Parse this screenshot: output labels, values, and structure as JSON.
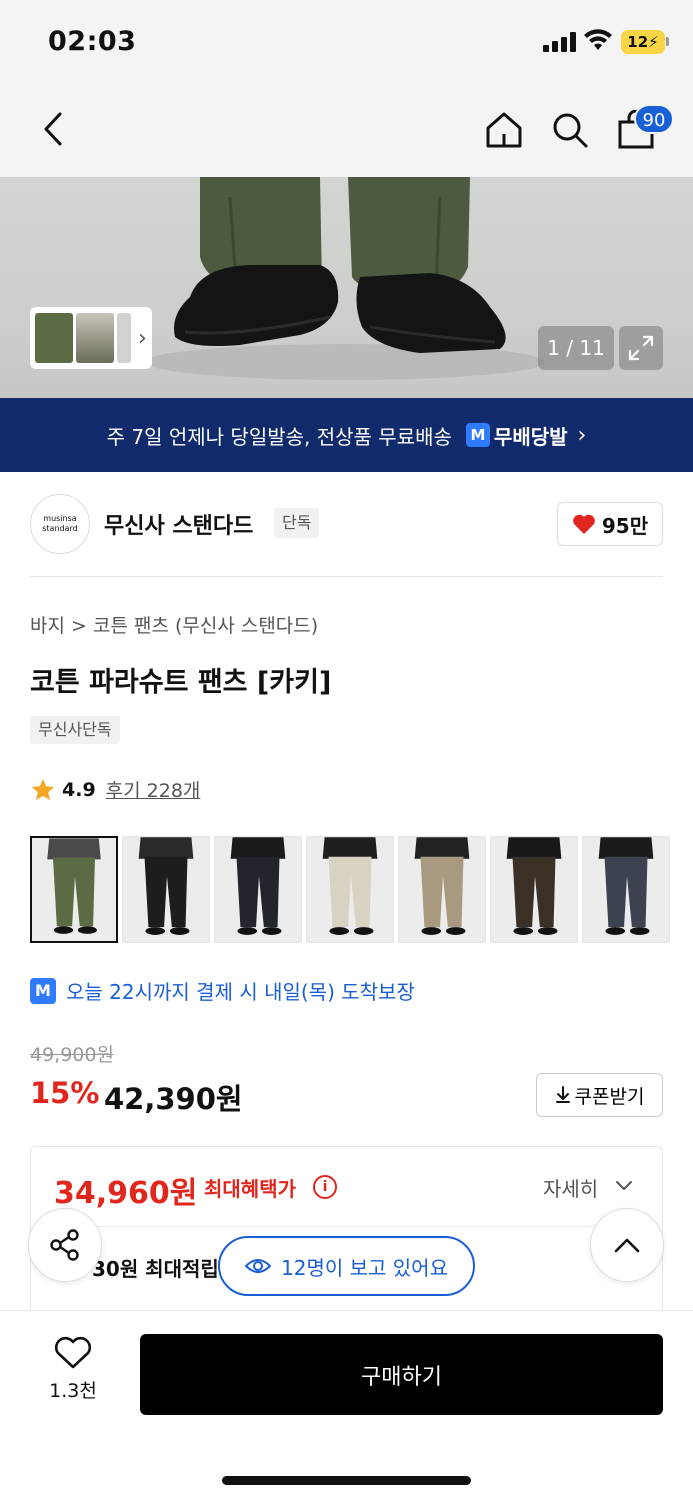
{
  "status_bar": {
    "time": "02:03",
    "battery": "12"
  },
  "nav": {
    "cart_count": "90"
  },
  "gallery": {
    "counter": "1 / 11"
  },
  "banner": {
    "text": "주 7일 언제나 당일발송, 전상품 무료배송",
    "badge_letter": "M",
    "brand": "무배당발",
    "chevron": "›"
  },
  "brand": {
    "logo_line1": "musinsa",
    "logo_line2": "standard",
    "name": "무신사 스탠다드",
    "tag": "단독",
    "likes": "95만"
  },
  "product": {
    "breadcrumb": "바지 > 코튼 팬츠 (무신사 스탠다드)",
    "title": "코튼 파라슈트 팬츠 [카키]",
    "tag": "무신사단독",
    "rating": "4.9",
    "reviews": "후기 228개",
    "colors": [
      {
        "pants": "#5b6b44",
        "top": "#4a4a4a",
        "selected": true
      },
      {
        "pants": "#1d1d1d",
        "top": "#2a2a2a"
      },
      {
        "pants": "#22262c",
        "top": "#1a1a1a"
      },
      {
        "pants": "#d8d2c2",
        "top": "#1f1f1f"
      },
      {
        "pants": "#a89a80",
        "top": "#222222"
      },
      {
        "pants": "#3a3026",
        "top": "#181818"
      },
      {
        "pants": "#3d4250",
        "top": "#1a1a1a"
      }
    ]
  },
  "delivery": {
    "badge_letter": "M",
    "text": "오늘 22시까지 결제 시 내일(목) 도착보장"
  },
  "price": {
    "original": "49,900원",
    "discount": "15%",
    "sale": "42,390원",
    "coupon_label": "쿠폰받기"
  },
  "benefit": {
    "max_price": "34,960원",
    "max_label": "최대혜택가",
    "detail": "자세히",
    "points": "30원 최대적립"
  },
  "viewers": {
    "text": "12명이 보고 있어요"
  },
  "bottom_bar": {
    "wish_count": "1.3천",
    "buy_label": "구매하기"
  },
  "colors": {
    "accent_blue": "#1a5ed6",
    "sale_red": "#e0261d",
    "banner_navy": "#102a6b"
  }
}
